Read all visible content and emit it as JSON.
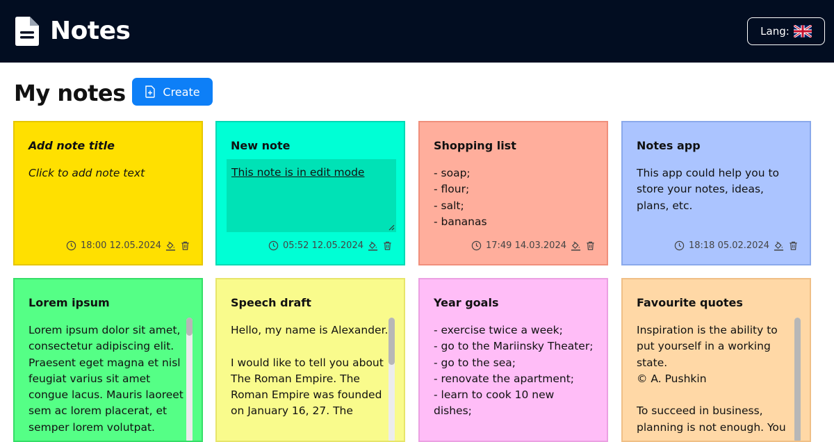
{
  "header": {
    "title": "Notes",
    "lang_label": "Lang:"
  },
  "page": {
    "heading": "My notes",
    "create_label": "Create"
  },
  "notes": [
    {
      "title": "Add note title",
      "text": "Click to add note text",
      "time": "18:00 12.05.2024",
      "color": "#ffe000",
      "border": "#e6c600"
    },
    {
      "title": "New note",
      "text": "This note is in edit mode",
      "time": "05:52 12.05.2024",
      "color": "#00ffd5",
      "border": "#00d9b5"
    },
    {
      "title": "Shopping list",
      "text": "- soap;\n- flour;\n- salt;\n- bananas",
      "time": "17:49 14.03.2024",
      "color": "#ffae9c",
      "border": "#f08f7b"
    },
    {
      "title": "Notes app",
      "text": "This app could help you to store your notes, ideas, plans, etc.",
      "time": "18:18 05.02.2024",
      "color": "#abc4ff",
      "border": "#8aa9eb"
    },
    {
      "title": "Lorem ipsum",
      "text": "Lorem ipsum dolor sit amet, consectetur adipiscing elit. Praesent eget magna et nisl feugiat varius sit amet congue lacus. Mauris laoreet sem ac lorem placerat, et semper lorem volutpat.",
      "color": "#55ff86",
      "border": "#35de67"
    },
    {
      "title": "Speech draft",
      "text": "Hello, my name is Alexander.\n\nI would like to tell you about The Roman Empire. The Roman Empire was founded on January 16, 27. The",
      "color": "#f9fb8c",
      "border": "#e7e56a"
    },
    {
      "title": "Year goals",
      "text": "- exercise twice a week;\n- go to the Mariinsky Theater;\n- go to the sea;\n- renovate the apartment;\n- learn to cook 10 new dishes;",
      "color": "#ffbdf7",
      "border": "#eba0e2"
    },
    {
      "title": "Favourite quotes",
      "text": "Inspiration is the ability to put yourself in a working state.\n© A. Pushkin\n\nTo succeed in business, planning is not enough. You",
      "color": "#ffd8a6",
      "border": "#f0bf86"
    }
  ],
  "icons": {
    "logo": "document-icon",
    "lang_flag": "uk-flag-icon",
    "create": "file-plus-icon",
    "time": "clock-icon",
    "color": "paint-bucket-icon",
    "delete": "trash-icon"
  },
  "colors": {
    "header_bg": "#020d21",
    "accent": "#0d7ff7"
  }
}
